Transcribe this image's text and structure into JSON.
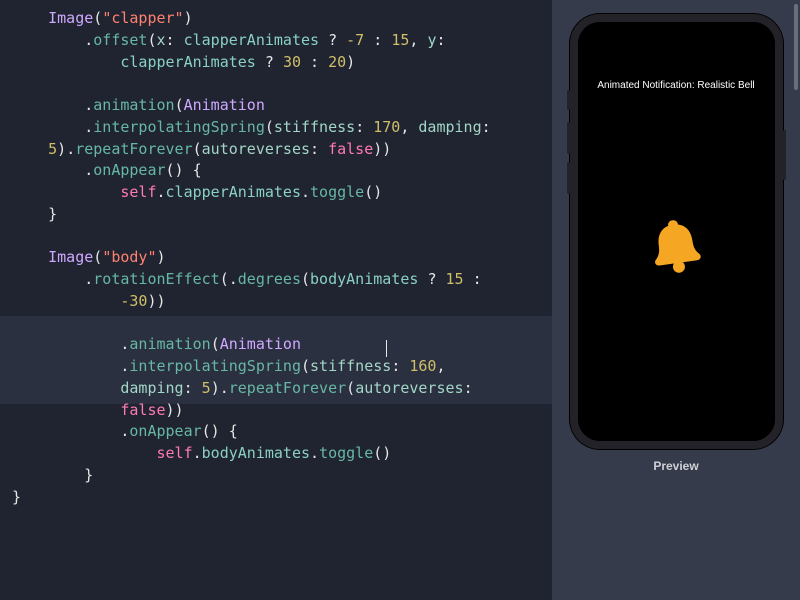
{
  "editor": {
    "tokens": {
      "Image": "Image",
      "Animation": "Animation",
      "clapper_str": "\"clapper\"",
      "body_str": "\"body\"",
      "offset": "offset",
      "animation": "animation",
      "interpolatingSpring": "interpolatingSpring",
      "repeatForever": "repeatForever",
      "onAppear": "onAppear",
      "rotationEffect": "rotationEffect",
      "degrees": "degrees",
      "toggle": "toggle",
      "x_label": "x",
      "y_label": "y",
      "stiffness_label": "stiffness",
      "damping_label": "damping",
      "autoreverses_label": "autoreverses",
      "clapperAnimates": "clapperAnimates",
      "bodyAnimates": "bodyAnimates",
      "self_kw": "self",
      "false_kw": "false",
      "neg7": "-7",
      "n15": "15",
      "n30": "30",
      "n20": "20",
      "n170": "170",
      "n160": "160",
      "n5": "5",
      "neg30": "-30",
      "q": "?",
      "colon": ":",
      "colonSp": ": ",
      "comma": ",",
      "dot": ".",
      "open": "(",
      "close": ")",
      "obrace": "{",
      "cbrace": "}"
    },
    "cursor_after_value": "160"
  },
  "preview": {
    "screen_title": "Animated Notification: Realistic Bell",
    "label": "Preview",
    "bell_color": "#f5a623"
  }
}
